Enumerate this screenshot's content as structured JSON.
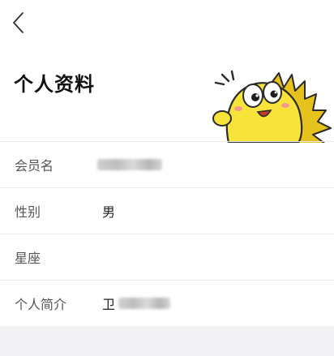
{
  "header": {
    "title": "个人资料"
  },
  "profile": {
    "rows": [
      {
        "label": "会员名",
        "value": "",
        "redacted": true
      },
      {
        "label": "性别",
        "value": "男",
        "redacted": false
      },
      {
        "label": "星座",
        "value": "",
        "redacted": false
      },
      {
        "label": "个人简介",
        "value": "卫",
        "redacted": true
      }
    ]
  },
  "colors": {
    "mascot_body": "#f7e33a",
    "mascot_fin": "#e6c21c",
    "footer_band": "#f3f3f5"
  },
  "icons": {
    "back": "chevron-left-icon",
    "mascot": "yellow-fish-mascot"
  }
}
